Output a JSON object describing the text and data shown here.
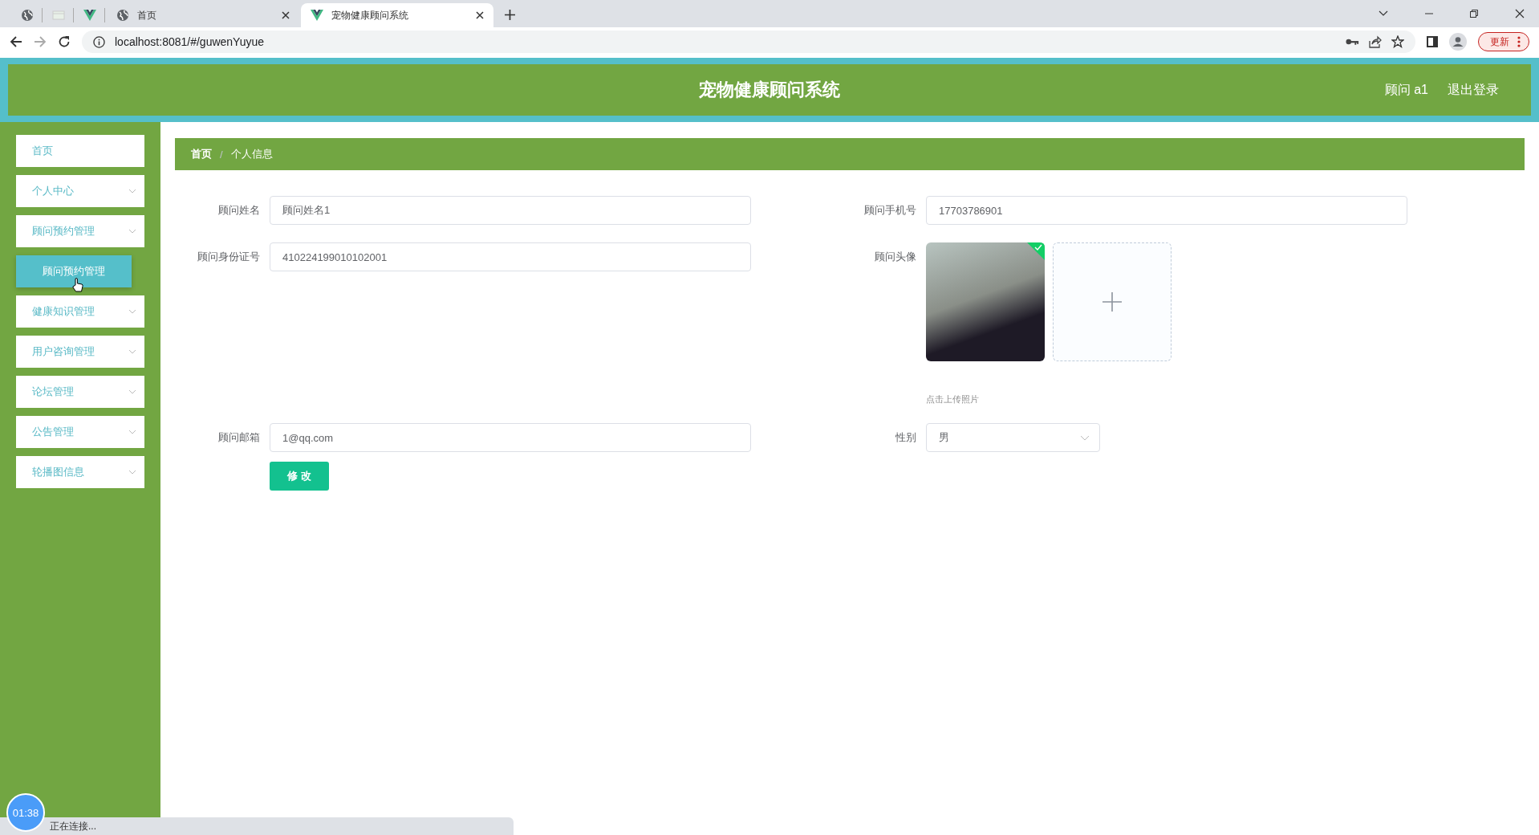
{
  "browser": {
    "tabs": [
      {
        "kind": "globe",
        "selected": false
      },
      {
        "kind": "sheet",
        "selected": false
      },
      {
        "kind": "vue",
        "selected": false
      },
      {
        "kind": "globe",
        "label": "首页",
        "selected": false
      },
      {
        "kind": "vue",
        "label": "宠物健康顾问系统",
        "selected": true
      }
    ],
    "url": "localhost:8081/#/guwenYuyue",
    "update_button": "更新"
  },
  "header": {
    "title": "宠物健康顾问系统",
    "user": "顾问 a1",
    "logout": "退出登录"
  },
  "sidebar": {
    "items": [
      {
        "label": "首页",
        "kind": "link"
      },
      {
        "label": "个人中心",
        "kind": "menu"
      },
      {
        "label": "顾问预约管理",
        "kind": "menu",
        "popup": {
          "label": "顾问预约管理"
        }
      },
      {
        "label": "健康知识管理",
        "kind": "menu"
      },
      {
        "label": "用户咨询管理",
        "kind": "menu"
      },
      {
        "label": "论坛管理",
        "kind": "menu"
      },
      {
        "label": "公告管理",
        "kind": "menu"
      },
      {
        "label": "轮播图信息",
        "kind": "menu"
      }
    ]
  },
  "breadcrumb": {
    "items": [
      "首页",
      "个人信息"
    ],
    "separator": "/"
  },
  "form": {
    "rows": [
      [
        {
          "kind": "text",
          "label": "顾问姓名",
          "value": "顾问姓名1"
        },
        {
          "kind": "text",
          "label": "顾问手机号",
          "value": "17703786901"
        }
      ],
      [
        {
          "kind": "text",
          "label": "顾问身份证号",
          "value": "410224199010102001"
        },
        {
          "kind": "avatar",
          "label": "顾问头像",
          "uploaded": true,
          "hint": "点击上传照片"
        }
      ],
      [
        {
          "kind": "text",
          "label": "顾问邮箱",
          "value": "1@qq.com"
        },
        {
          "kind": "select",
          "label": "性别",
          "value": "男"
        }
      ]
    ],
    "submit": "修 改"
  },
  "status_bar": {
    "text": "正在连接...",
    "timer": "01:38"
  }
}
